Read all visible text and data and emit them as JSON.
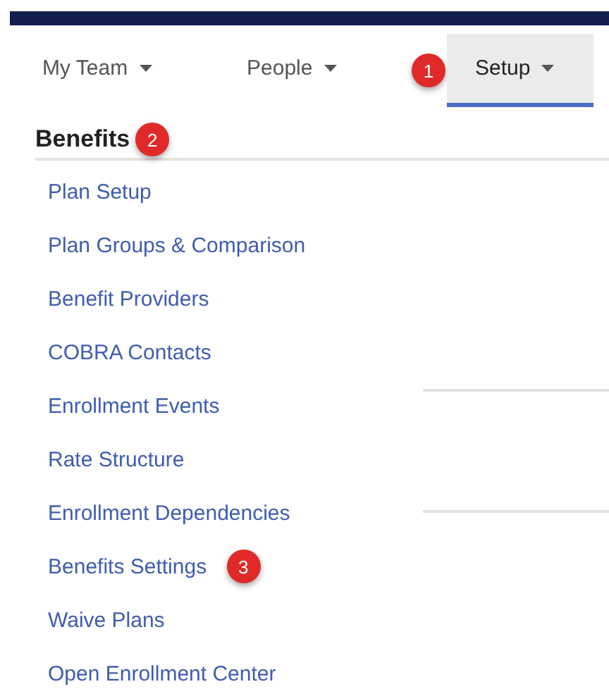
{
  "nav": {
    "tabs": [
      {
        "label": "My Team",
        "selected": false
      },
      {
        "label": "People",
        "selected": false
      },
      {
        "label": "Setup",
        "selected": true,
        "badge": "1"
      }
    ]
  },
  "menu": {
    "title": "Benefits",
    "badge": "2",
    "items": [
      {
        "label": "Plan Setup"
      },
      {
        "label": "Plan Groups & Comparison"
      },
      {
        "label": "Benefit Providers"
      },
      {
        "label": "COBRA Contacts"
      },
      {
        "label": "Enrollment Events"
      },
      {
        "label": "Rate Structure"
      },
      {
        "label": "Enrollment Dependencies"
      },
      {
        "label": "Benefits Settings",
        "badge": "3"
      },
      {
        "label": "Waive Plans"
      },
      {
        "label": "Open Enrollment Center"
      }
    ]
  }
}
